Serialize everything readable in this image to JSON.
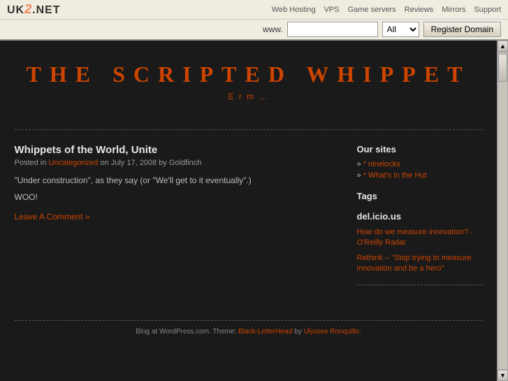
{
  "topbar": {
    "logo": "UK2.NET",
    "nav": {
      "web_hosting": "Web Hosting",
      "vps": "VPS",
      "game_servers": "Game servers",
      "reviews": "Reviews",
      "mirrors": "Mirrors",
      "support": "Support"
    }
  },
  "domainbar": {
    "label": "www.",
    "placeholder": "",
    "tld_default": "All",
    "register_btn": "Register Domain"
  },
  "blog": {
    "title": "THE SCRIPTED WHIPPET",
    "subtitle": "E r m …",
    "post": {
      "title": "Whippets of the World, Unite",
      "meta_prefix": "Posted in",
      "category": "Uncategorized",
      "meta_middle": "on July 17, 2008 by Goldfinch",
      "body": "\"Under construction\", as they say (or \"We'll get to it eventually\".)",
      "woof": "WOO!",
      "comment_link": "Leave A Comment »"
    },
    "sidebar": {
      "our_sites_title": "Our sites",
      "our_sites": [
        {
          "label": "* ninelocks"
        },
        {
          "label": "* What's in the Hut"
        }
      ],
      "tags_title": "Tags",
      "delicious_title": "del.icio.us",
      "delicious_links": [
        {
          "text": "How do we measure innovation? - O'Reilly Radar"
        },
        {
          "text": "Rethink – \"Stop trying to measure innovation and be a hero\""
        }
      ]
    },
    "footer": {
      "text_prefix": "Blog at WordPress.com. Theme:",
      "theme": "Black-LetterHead",
      "text_by": "by",
      "author": "Ulysses Ronquillo",
      "suffix": "."
    }
  }
}
